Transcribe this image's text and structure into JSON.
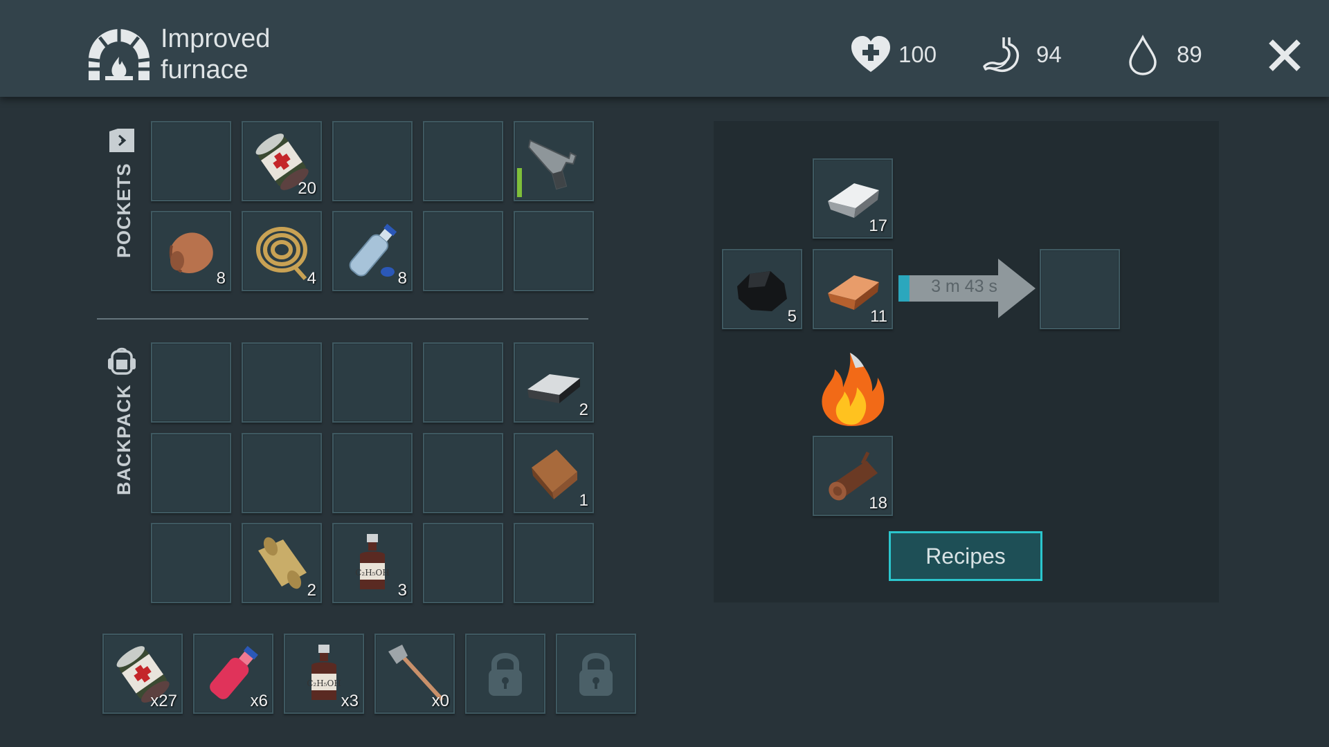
{
  "header": {
    "station_icon": "furnace-icon",
    "title": "Improved furnace",
    "stats": {
      "health": {
        "icon": "heart-icon",
        "value": "100"
      },
      "hunger": {
        "icon": "stomach-icon",
        "value": "94"
      },
      "thirst": {
        "icon": "water-drop-icon",
        "value": "89"
      }
    },
    "close_icon": "close-icon"
  },
  "pockets": {
    "label": "POCKETS",
    "icon": "pockets-icon",
    "slots": [
      {
        "item": null,
        "count": ""
      },
      {
        "item": "bandage-can",
        "count": "20"
      },
      {
        "item": null,
        "count": ""
      },
      {
        "item": null,
        "count": ""
      },
      {
        "item": "pistol",
        "count": "",
        "durability": 1.0
      },
      {
        "item": "leather-scrap",
        "count": "8"
      },
      {
        "item": "rope",
        "count": "4"
      },
      {
        "item": "water-bottle",
        "count": "8"
      },
      {
        "item": null,
        "count": ""
      },
      {
        "item": null,
        "count": ""
      }
    ]
  },
  "backpack": {
    "label": "BACKPACK",
    "icon": "backpack-icon",
    "slots": [
      {
        "item": null,
        "count": ""
      },
      {
        "item": null,
        "count": ""
      },
      {
        "item": null,
        "count": ""
      },
      {
        "item": null,
        "count": ""
      },
      {
        "item": "iron-ingot",
        "count": "2"
      },
      {
        "item": null,
        "count": ""
      },
      {
        "item": null,
        "count": ""
      },
      {
        "item": null,
        "count": ""
      },
      {
        "item": null,
        "count": ""
      },
      {
        "item": "leather",
        "count": "1"
      },
      {
        "item": null,
        "count": ""
      },
      {
        "item": "paper-scroll",
        "count": "2"
      },
      {
        "item": "alcohol-bottle",
        "count": "3"
      },
      {
        "item": null,
        "count": ""
      },
      {
        "item": null,
        "count": ""
      }
    ]
  },
  "hotbar": [
    {
      "item": "bandage-can",
      "count": "x27"
    },
    {
      "item": "red-drink-bottle",
      "count": "x6"
    },
    {
      "item": "alcohol-bottle",
      "count": "x3"
    },
    {
      "item": "hatchet",
      "count": "x0"
    },
    {
      "item": "locked",
      "count": ""
    },
    {
      "item": "locked",
      "count": ""
    }
  ],
  "furnace": {
    "input_top": {
      "item": "silver-ingot",
      "count": "17"
    },
    "input_left": {
      "item": "coal",
      "count": "5"
    },
    "input_middle": {
      "item": "copper-ingot",
      "count": "11"
    },
    "progress": 0.08,
    "timer": "3 m 43 s",
    "output": {
      "item": null,
      "count": ""
    },
    "flame_icon": "fire-icon",
    "fuel": {
      "item": "wood-log",
      "count": "18"
    },
    "recipes_label": "Recipes"
  },
  "colors": {
    "background": "#283339",
    "header": "#33434b",
    "slot": "#2c3d44",
    "slot_border": "#3f5961",
    "accent": "#2bc6cd",
    "durability": "#7fbf3a"
  }
}
